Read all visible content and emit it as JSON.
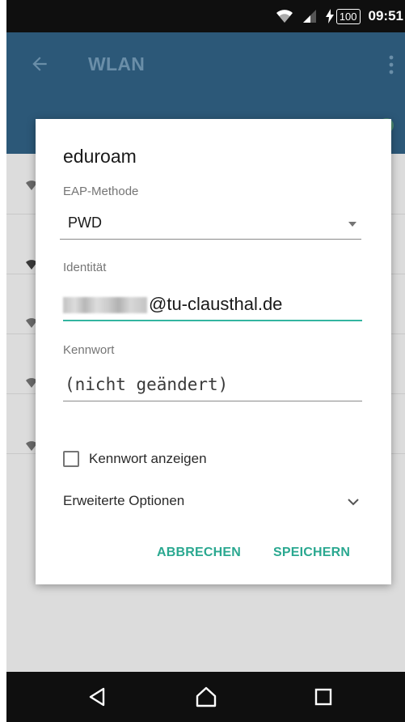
{
  "status_bar": {
    "battery": "100",
    "time": "09:51"
  },
  "app_bar": {
    "title": "WLAN"
  },
  "dialog": {
    "title": "eduroam",
    "eap_label": "EAP-Methode",
    "eap_value": "PWD",
    "identity_label": "Identität",
    "identity_value": "@tu-clausthal.de",
    "password_label": "Kennwort",
    "password_placeholder": "(nicht geändert)",
    "show_password_label": "Kennwort anzeigen",
    "advanced_label": "Erweiterte Optionen",
    "cancel_label": "ABBRECHEN",
    "save_label": "SPEICHERN"
  },
  "colors": {
    "app_bar": "#2c5878",
    "accent": "#2aa890",
    "focus_line": "#33b5a0",
    "scrim_background": "#dcdcdc"
  },
  "icons": [
    "wifi-icon",
    "signal-icon",
    "charging-icon",
    "back-arrow-icon",
    "overflow-menu-icon",
    "dropdown-caret-icon",
    "chevron-down-icon",
    "nav-back-icon",
    "nav-home-icon",
    "nav-recents-icon"
  ]
}
